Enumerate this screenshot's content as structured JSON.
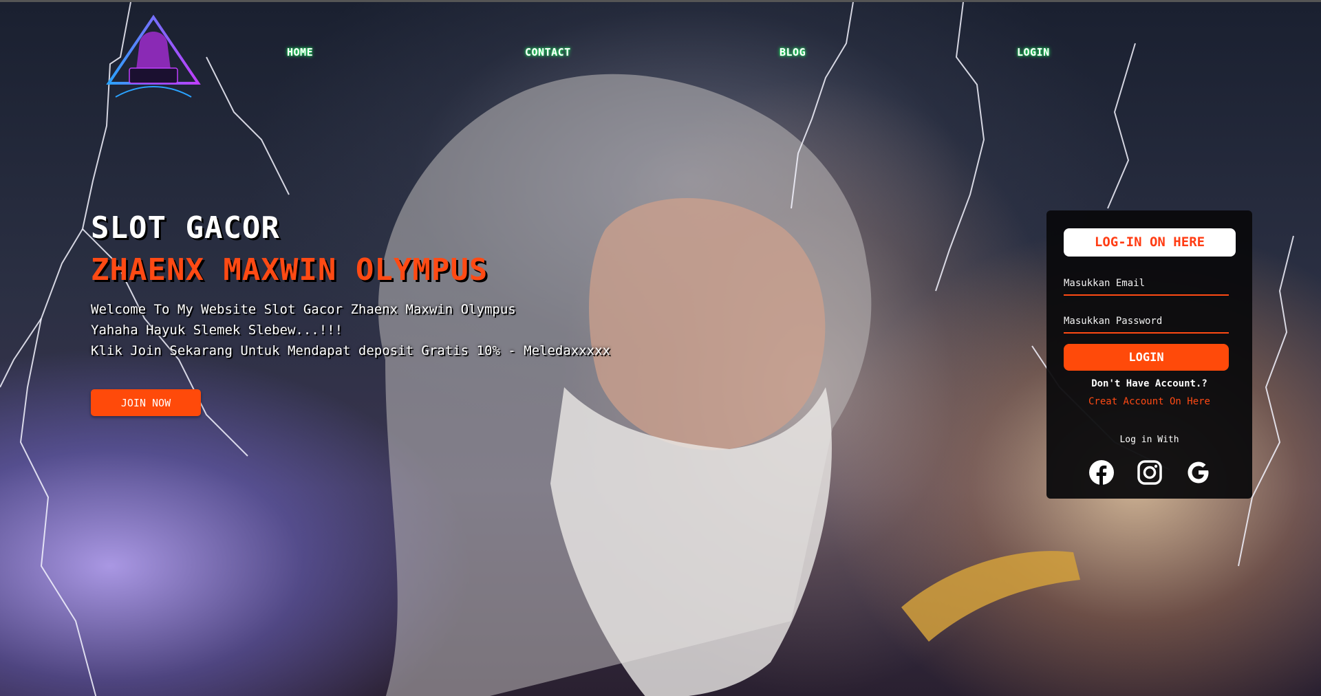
{
  "nav": {
    "items": [
      "HOME",
      "CONTACT",
      "BLOG",
      "LOGIN"
    ]
  },
  "hero": {
    "title": "SLOT GACOR",
    "subtitle": "ZHAENX MAXWIN OLYMPUS",
    "lines": [
      "Welcome To My Website Slot Gacor Zhaenx Maxwin Olympus",
      "Yahaha Hayuk Slemek Slebew...!!!",
      "Klik Join Sekarang Untuk Mendapat deposit Gratis 10% - Meledaxxxxx"
    ],
    "join_label": "JOIN NOW"
  },
  "login": {
    "header": "LOG-IN ON HERE",
    "email_placeholder": "Masukkan Email",
    "password_placeholder": "Masukkan Password",
    "button_label": "LOGIN",
    "no_account_text": "Don't Have Account.?",
    "create_link": "Creat Account On Here",
    "login_with": "Log in With"
  },
  "icons": {
    "social": [
      "facebook-icon",
      "instagram-icon",
      "google-icon"
    ]
  },
  "colors": {
    "accent": "#ff4a0a",
    "nav_glow": "#22ff66",
    "panel": "#0a0a0c"
  }
}
